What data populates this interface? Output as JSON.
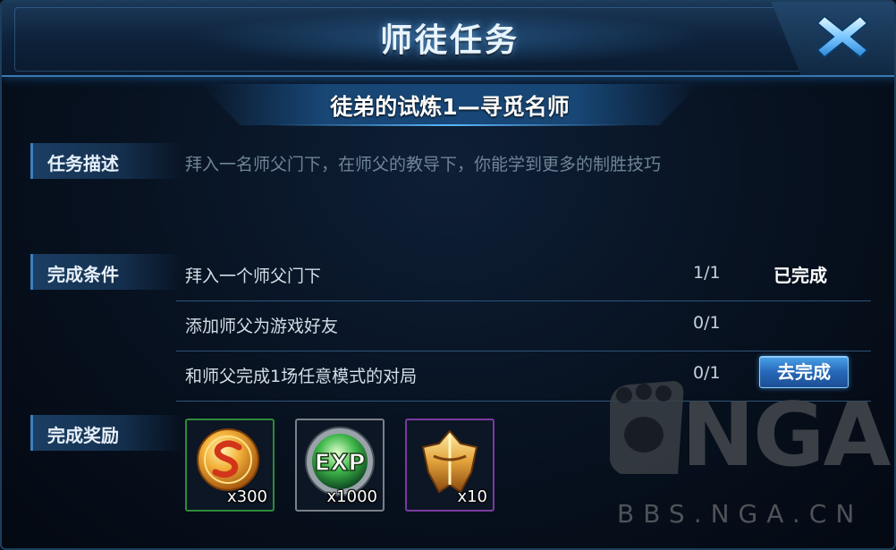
{
  "header": {
    "title": "师徒任务",
    "close_icon": "close-x-icon"
  },
  "subtitle": "徒弟的试炼1—寻觅名师",
  "description": {
    "label": "任务描述",
    "text": "拜入一名师父门下，在师父的教导下，你能学到更多的制胜技巧"
  },
  "conditions": {
    "label": "完成条件",
    "rows": [
      {
        "text": "拜入一个师父门下",
        "progress": "1/1",
        "status": "已完成"
      },
      {
        "text": "添加师父为游戏好友",
        "progress": "0/1",
        "status": ""
      },
      {
        "text": "和师父完成1场任意模式的对局",
        "progress": "0/1",
        "button": "去完成"
      }
    ]
  },
  "rewards": {
    "label": "完成奖励",
    "items": [
      {
        "icon": "gold-coin-icon",
        "count": "x300",
        "border_color": "#2f8a3a"
      },
      {
        "icon": "exp-orb-icon",
        "count": "x1000",
        "border_color": "#7a8088"
      },
      {
        "icon": "golden-helmet-icon",
        "count": "x10",
        "border_color": "#7a3aa0"
      }
    ]
  },
  "watermark": {
    "brand": "NGA",
    "url": "BBS.NGA.CN"
  },
  "colors": {
    "accent": "#3b7fc0",
    "button": "#2668b8",
    "panel": "#07111f"
  }
}
